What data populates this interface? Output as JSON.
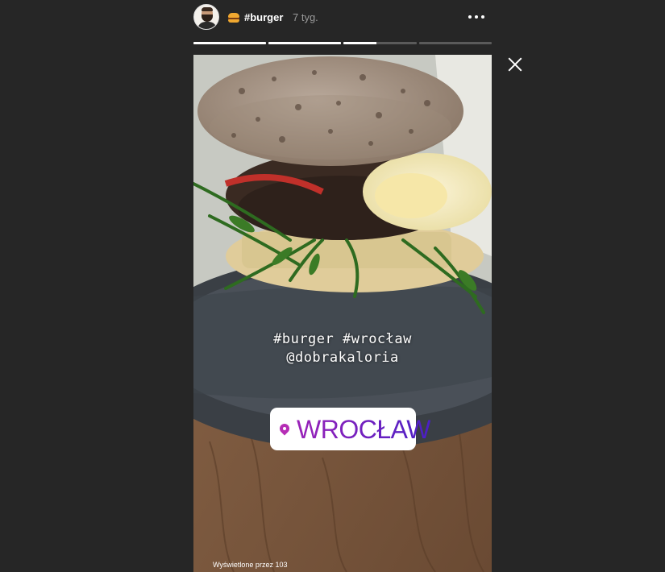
{
  "header": {
    "avatar_name": "avatar",
    "emoji_icon": "burger-emoji-icon",
    "hashtag": "#burger",
    "time_ago": "7 tyg.",
    "more_icon": "more-options-icon"
  },
  "progress": {
    "segments": [
      {
        "fill": 1.0
      },
      {
        "fill": 1.0
      },
      {
        "fill": 0.45
      },
      {
        "fill": 0.0
      }
    ]
  },
  "close_icon": "close-icon",
  "story": {
    "caption_line1": "#burger #wrocław",
    "caption_line2": "@dobrakaloria",
    "location_icon": "location-pin-icon",
    "location": "WROCŁAW",
    "views": "Wyświetlone przez 103"
  },
  "colors": {
    "background": "#262626",
    "location_gradient_start": "#9a22b8",
    "location_gradient_end": "#4a1fc6"
  }
}
